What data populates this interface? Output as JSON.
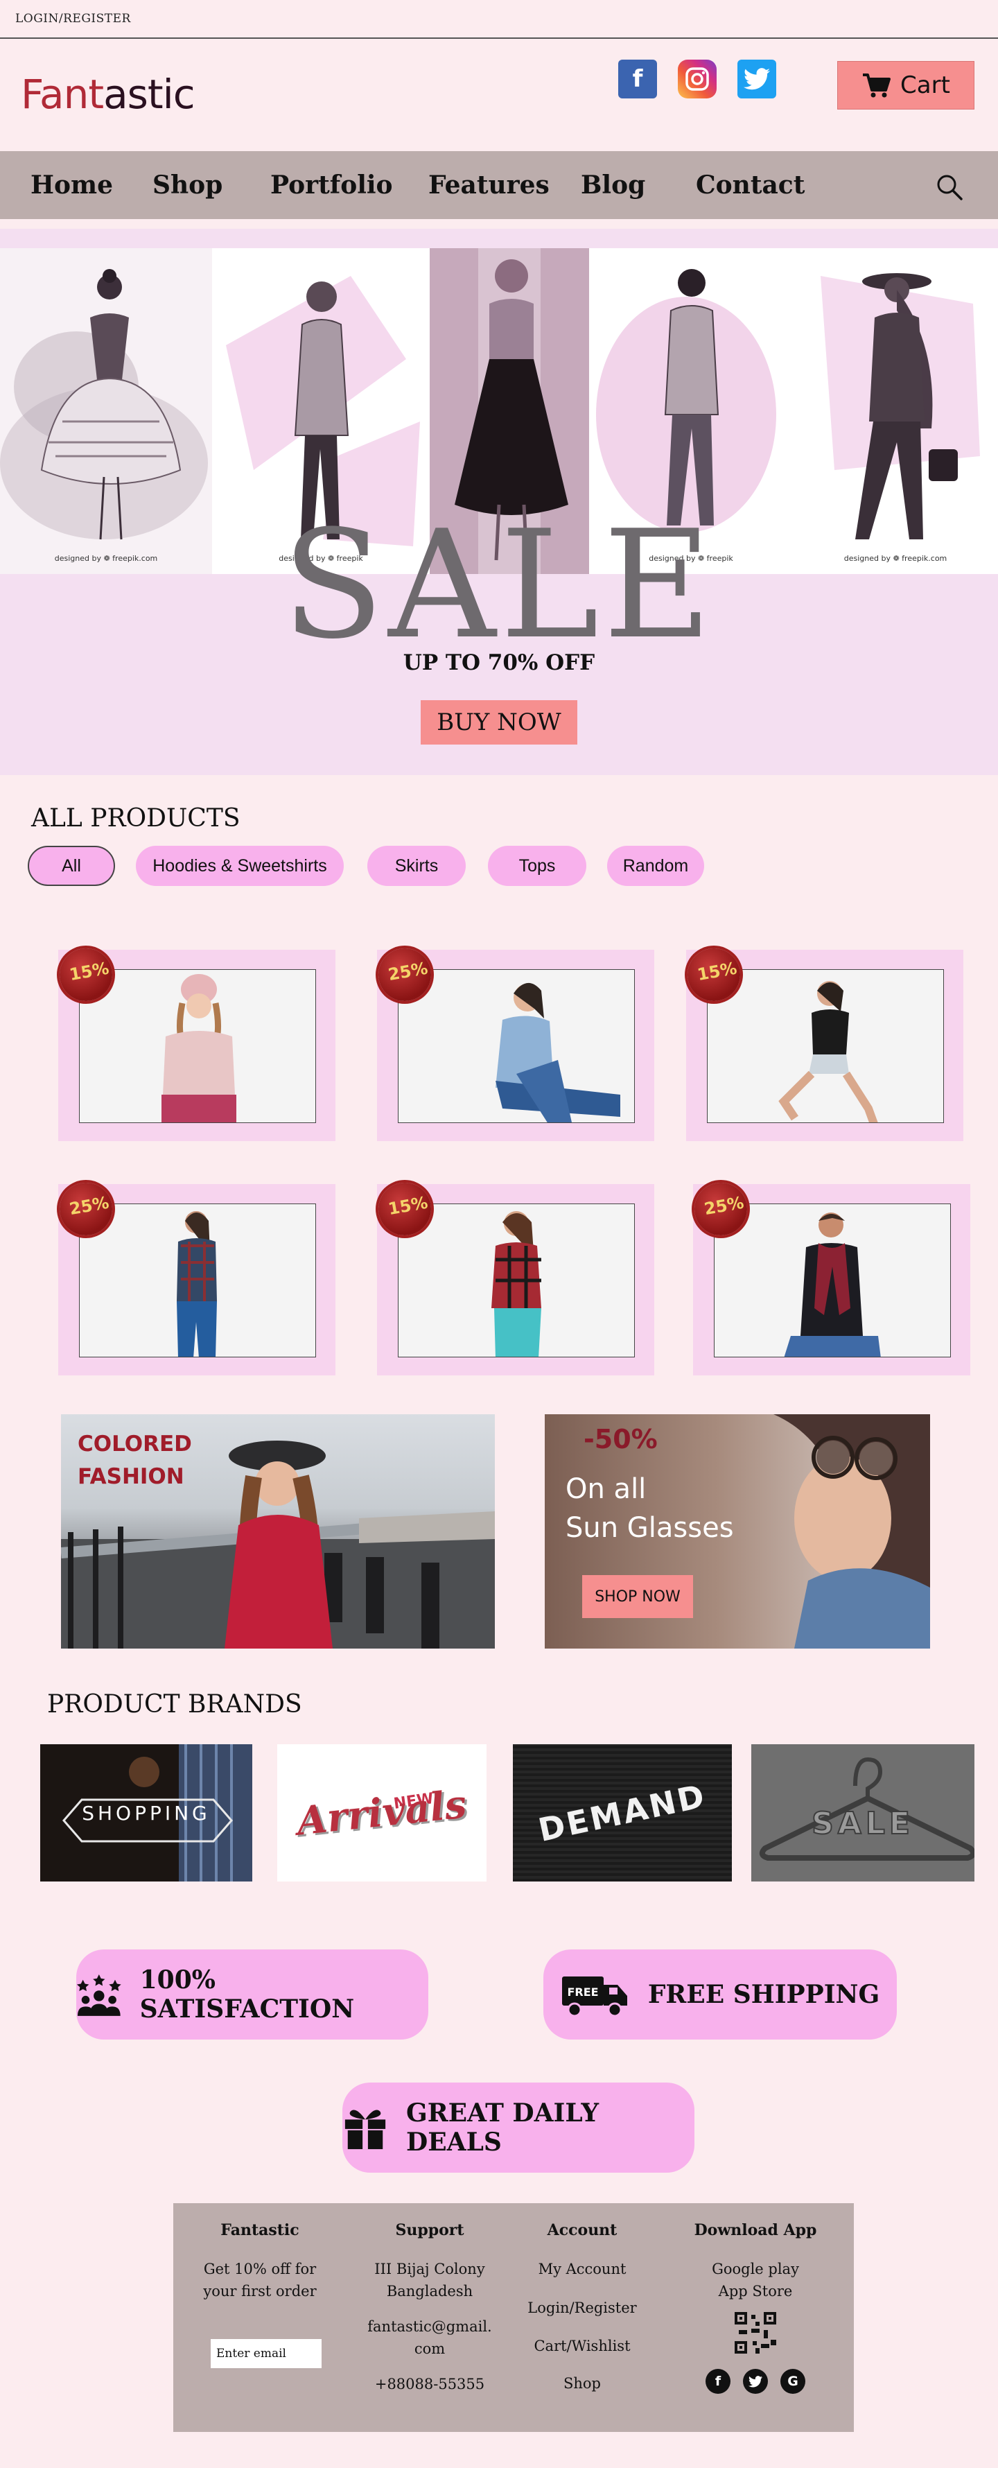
{
  "topbar": {
    "login_label": "LOGIN/REGISTER"
  },
  "header": {
    "logo_part1": "Fant",
    "logo_part2": "astic",
    "cart_label": "Cart"
  },
  "nav": {
    "items": [
      "Home",
      "Shop",
      "Portfolio",
      "Features",
      "Blog",
      "Contact"
    ]
  },
  "hero": {
    "panel_credits": [
      "designed by ❁ freepik.com",
      "designed by ❁ freepik",
      "",
      "designed by ❁ freepik",
      "designed by ❁ freepik.com"
    ],
    "sale_word": "SALE",
    "subtitle": "UP TO 70% OFF",
    "button_label": "BUY NOW"
  },
  "products": {
    "title": "ALL PRODUCTS",
    "filters": [
      "All",
      "Hoodies & Sweetshirts",
      "Skirts",
      "Tops",
      "Random"
    ],
    "active_filter": "All",
    "items": [
      {
        "discount": "15%"
      },
      {
        "discount": "25%"
      },
      {
        "discount": "15%"
      },
      {
        "discount": "25%"
      },
      {
        "discount": "15%"
      },
      {
        "discount": "25%"
      }
    ]
  },
  "promos": {
    "colored_fashion_line1": "COLORED",
    "colored_fashion_line2": "FASHION",
    "glasses_discount": "-50%",
    "glasses_line1": "On all",
    "glasses_line2": "Sun Glasses",
    "shop_now_label": "SHOP NOW"
  },
  "brands": {
    "title": "PRODUCT BRANDS",
    "items": [
      "SHOPPING",
      "Arrivals",
      "DEMAND",
      "SALE"
    ],
    "new_label": "NEW"
  },
  "features": {
    "satisfaction": "100% SATISFACTION",
    "free_badge": "FREE",
    "shipping": "FREE SHIPPING",
    "deals": "GREAT DAILY DEALS"
  },
  "footer": {
    "col1": {
      "heading": "Fantastic",
      "line1": "Get 10% off for",
      "line2": "your first order",
      "email_placeholder": "Enter email"
    },
    "col2": {
      "heading": "Support",
      "address1": "III Bijaj Colony",
      "address2": "Bangladesh",
      "email1": "fantastic@gmail.",
      "email2": "com",
      "phone": "+88088-55355"
    },
    "col3": {
      "heading": "Account",
      "links": [
        "My Account",
        "Login/Register",
        "Cart/Wishlist",
        "Shop"
      ]
    },
    "col4": {
      "heading": "Download App",
      "google": "Google play",
      "apple": "App Store"
    }
  },
  "colors": {
    "background": "#fcecef",
    "accent_salmon": "#f68f8f",
    "nav_bg": "#bcadac",
    "pink_pill": "#f8b1ec",
    "logo_red": "#b02a37"
  }
}
